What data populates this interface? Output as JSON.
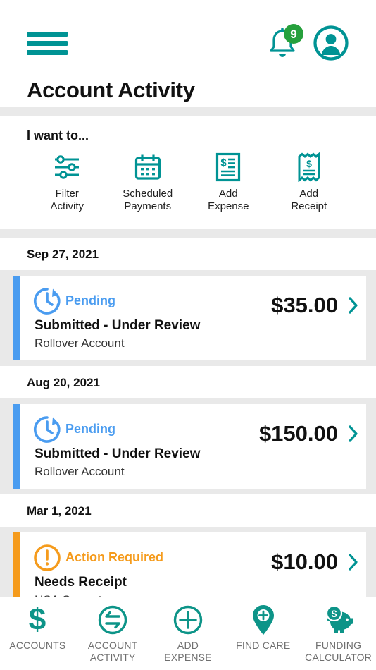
{
  "header": {
    "menu_icon": "hamburger-menu-icon",
    "notification_icon": "bell-icon",
    "notification_count": "9",
    "profile_icon": "user-avatar-icon",
    "title": "Account Activity"
  },
  "quick_actions": {
    "title": "I want to...",
    "items": [
      {
        "icon": "filter-sliders-icon",
        "line1": "Filter",
        "line2": "Activity"
      },
      {
        "icon": "calendar-icon",
        "line1": "Scheduled",
        "line2": "Payments"
      },
      {
        "icon": "document-dollar-icon",
        "line1": "Add",
        "line2": "Expense"
      },
      {
        "icon": "receipt-dollar-icon",
        "line1": "Add",
        "line2": "Receipt"
      }
    ]
  },
  "activity": {
    "groups": [
      {
        "date": "Sep 27, 2021",
        "items": [
          {
            "status": "Pending",
            "status_icon": "clock-pending-icon",
            "description": "Submitted - Under Review",
            "account": "Rollover Account",
            "amount": "$35.00",
            "accent": "#4a9cf0",
            "chevron": "chevron-right-icon"
          }
        ]
      },
      {
        "date": "Aug 20, 2021",
        "items": [
          {
            "status": "Pending",
            "status_icon": "clock-pending-icon",
            "description": "Submitted - Under Review",
            "account": "Rollover Account",
            "amount": "$150.00",
            "accent": "#4a9cf0",
            "chevron": "chevron-right-icon"
          }
        ]
      },
      {
        "date": "Mar 1, 2021",
        "items": [
          {
            "status": "Action Required",
            "status_icon": "alert-exclamation-icon",
            "description": "Needs Receipt",
            "account": "HSA Current",
            "amount": "$10.00",
            "accent": "#f59b1c",
            "chevron": "chevron-right-icon"
          }
        ]
      }
    ]
  },
  "bottom_nav": {
    "items": [
      {
        "icon": "dollar-sign-icon",
        "line1": "ACCOUNTS",
        "line2": ""
      },
      {
        "icon": "transfer-arrows-icon",
        "line1": "ACCOUNT",
        "line2": "ACTIVITY"
      },
      {
        "icon": "plus-circle-icon",
        "line1": "ADD",
        "line2": "EXPENSE"
      },
      {
        "icon": "map-pin-plus-icon",
        "line1": "FIND CARE",
        "line2": ""
      },
      {
        "icon": "piggy-bank-icon",
        "line1": "FUNDING",
        "line2": "CALCULATOR"
      }
    ]
  },
  "colors": {
    "brand_teal": "#009394",
    "badge_green": "#26a03c",
    "pending_blue": "#4a9cf0",
    "action_orange": "#f59b1c",
    "band_gray": "#e9e9e9"
  }
}
